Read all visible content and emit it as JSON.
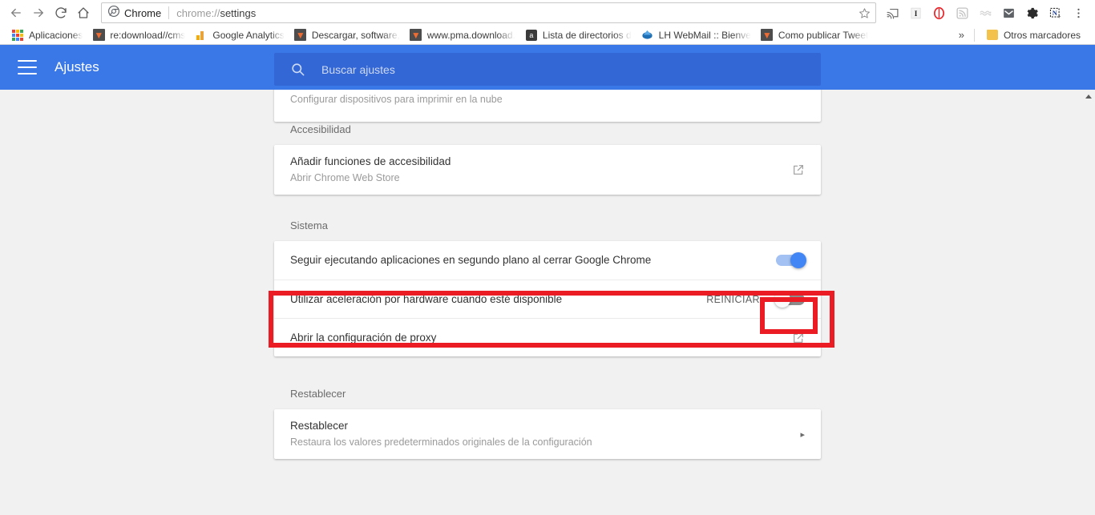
{
  "browser": {
    "nav": {
      "back": "back-arrow",
      "forward": "forward-arrow",
      "reload": "reload",
      "home": "home"
    },
    "omnibox": {
      "chip_label": "Chrome",
      "url_prefix": "chrome://",
      "url_bold": "settings",
      "star": "bookmark-star"
    },
    "toolbar_icons": [
      {
        "name": "cast-icon",
        "glyph": "cast"
      },
      {
        "name": "italic-i-extension-icon",
        "glyph": "I"
      },
      {
        "name": "opera-o-extension-icon",
        "glyph": "O"
      },
      {
        "name": "rss-feed-extension-icon",
        "glyph": "rss"
      },
      {
        "name": "wave-extension-icon",
        "glyph": "wave"
      },
      {
        "name": "gmail-m-extension-icon",
        "glyph": "M"
      },
      {
        "name": "gear-extension-icon",
        "glyph": "gear"
      },
      {
        "name": "evernote-n-extension-icon",
        "glyph": "N"
      },
      {
        "name": "chrome-menu-icon",
        "glyph": "kebab"
      }
    ],
    "bookmarks": [
      {
        "label": "Aplicaciones",
        "icon": "apps-grid-icon"
      },
      {
        "label": "re:download//cms",
        "icon": "firefox-favicon"
      },
      {
        "label": "Google Analytics",
        "icon": "google-analytics-favicon"
      },
      {
        "label": "Descargar, software, ",
        "icon": "firefox-favicon"
      },
      {
        "label": "www.pma.download.",
        "icon": "firefox-favicon"
      },
      {
        "label": "Lista de directorios d",
        "icon": "letter-a-favicon"
      },
      {
        "label": "LH WebMail :: Bienve",
        "icon": "blue-diamond-favicon"
      },
      {
        "label": "Como publicar Tweet",
        "icon": "firefox-favicon"
      }
    ],
    "bookmarks_overflow": {
      "chevrons": "»",
      "other_label": "Otros marcadores",
      "other_icon": "folder-icon"
    }
  },
  "settings": {
    "title": "Ajustes",
    "menu_icon": "hamburger-menu-icon",
    "search": {
      "placeholder": "Buscar ajustes",
      "value": "",
      "icon": "search-icon"
    },
    "partial_card": {
      "subtitle": "Configurar dispositivos para imprimir en la nube",
      "arrow": "▸"
    },
    "sections": [
      {
        "label": "Accesibilidad",
        "rows": [
          {
            "title": "Añadir funciones de accesibilidad",
            "subtitle": "Abrir Chrome Web Store",
            "control": "external-link"
          }
        ]
      },
      {
        "label": "Sistema",
        "rows": [
          {
            "title": "Seguir ejecutando aplicaciones en segundo plano al cerrar Google Chrome",
            "subtitle": "",
            "control": "toggle-on"
          },
          {
            "title": "Utilizar aceleración por hardware cuando esté disponible",
            "subtitle": "",
            "control": "toggle-off",
            "action_label": "REINICIAR"
          },
          {
            "title": "Abrir la configuración de proxy",
            "subtitle": "",
            "control": "external-link"
          }
        ]
      },
      {
        "label": "Restablecer",
        "rows": [
          {
            "title": "Restablecer",
            "subtitle": "Restaura los valores predeterminados originales de la configuración",
            "control": "arrow"
          }
        ]
      }
    ]
  },
  "annotations": [
    {
      "name": "red-highlight-row",
      "color": "#ec1c24"
    },
    {
      "name": "red-highlight-toggle",
      "color": "#ec1c24"
    }
  ],
  "colors": {
    "header_blue": "#3b78e7",
    "search_blue": "#3367d6",
    "toggle_on": "#4285f4",
    "page_bg": "#f1f1f1",
    "annotation_red": "#ec1c24"
  }
}
